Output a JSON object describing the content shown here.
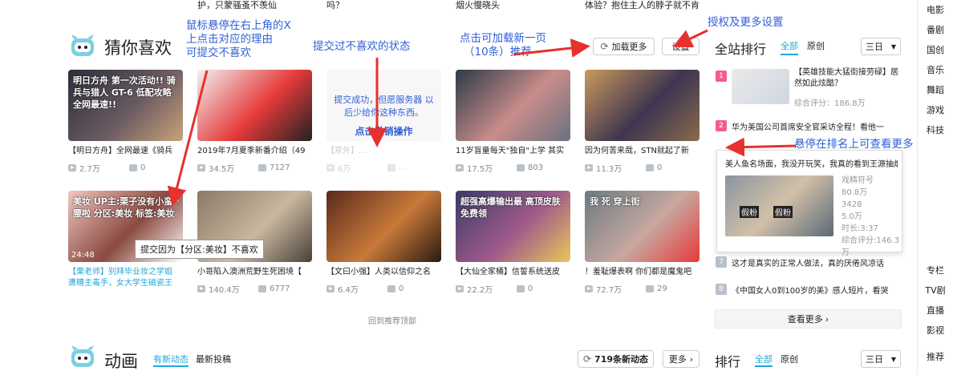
{
  "top_snippets": [
    "护，只蒙骚蚤不羡仙",
    "吗？",
    "烟火慢晓头",
    "体验？抱住主人的脖子就不肯"
  ],
  "section1": {
    "title": "猜你喜欢",
    "load_more_label": "加载更多",
    "settings_label": "设置",
    "back_to_top": "回到推荐顶部"
  },
  "cards_row1": [
    {
      "thumb_text": "明日方舟 第一次活动!! 骑兵与猎人 GT-6 低配攻略 全网最速!!",
      "title": "【明日方舟】全网最速《骑兵",
      "views": "2.7万",
      "danmaku": "0",
      "colors": [
        "#2b2f3a",
        "#6a5a62",
        "#c9a27a"
      ]
    },
    {
      "thumb_text": "",
      "title": "2019年7月夏季新番介绍（49",
      "views": "34.5万",
      "danmaku": "7127",
      "colors": [
        "#f1f1f1",
        "#e53a3a",
        "#222"
      ]
    },
    {
      "thumb_text": "提交成功，但愿服务器 以后少给你这种东西。",
      "undo_label": "点击撤销操作",
      "title": "【意外】...",
      "views": "6万",
      "danmaku": "...",
      "colors": [
        "#f7f7f7",
        "#e8d8dc",
        "#fff"
      ]
    },
    {
      "thumb_text": "",
      "title": "11岁盲童每天\"独自\"上学 其实",
      "views": "17.5万",
      "danmaku": "803",
      "colors": [
        "#2d3a48",
        "#c88d8a",
        "#6b7080"
      ]
    },
    {
      "thumb_text": "",
      "title": "因为何苦来哉，STN就起了新",
      "views": "11.3万",
      "danmaku": "0",
      "colors": [
        "#c99a5a",
        "#3d3550",
        "#8a6a4a"
      ]
    }
  ],
  "cards_row2": [
    {
      "thumb_text": "美妆 UP主:栗子没有小蛮腰啦 分区:美妆 标签:美妆",
      "duration": "24:48",
      "title": "【栗老师】别拜毕业妆之学姐 遭糟主毒手，女大学生磁瓷王",
      "views": "",
      "danmaku": "",
      "colors": [
        "#f2c6c0",
        "#8a4a40",
        "#fff"
      ]
    },
    {
      "thumb_text": "",
      "title": "小哥陷入澳洲荒野生死困境【",
      "views": "140.4万",
      "danmaku": "6777",
      "colors": [
        "#8a7a66",
        "#c8b8a0",
        "#4a4038"
      ]
    },
    {
      "thumb_text": "",
      "title": "【文曰小强】人类以信仰之名",
      "views": "6.4万",
      "danmaku": "0",
      "colors": [
        "#5a2a1a",
        "#c87a3a",
        "#2a1a10"
      ]
    },
    {
      "thumb_text": "超强高爆输出最 高顶皮肤免费领",
      "title": "【大仙全家桶】信誓系统送皮",
      "views": "22.2万",
      "danmaku": "0",
      "colors": [
        "#3a3a6a",
        "#a05a8a",
        "#e8c85a"
      ]
    },
    {
      "thumb_text": "我 死 穿上街",
      "title": "！羞耻爆表啊 你们都是魔鬼吧",
      "views": "72.7万",
      "danmaku": "29",
      "colors": [
        "#6a7a80",
        "#c8a8a0",
        "#e53a3a"
      ]
    }
  ],
  "dislike_tooltip": "提交因为【分区:美妆】不喜欢",
  "annotations": {
    "a1": [
      "鼠标悬停在右上角的X",
      "上点击对应的理由",
      "可提交不喜欢"
    ],
    "a2": "提交过不喜欢的状态",
    "a3": [
      "点击可加载新一页",
      "（10条）推荐"
    ],
    "a4": "授权及更多设置",
    "a5": "悬停在排名上可查看更多"
  },
  "ranking": {
    "title": "全站排行",
    "tab_all": "全部",
    "tab_original": "原创",
    "period": "三日",
    "items": [
      {
        "num": "1",
        "title": "【英雄技能大猛街接劳碌】居然如此炫酷？",
        "score": "综合评分：186.8万"
      },
      {
        "num": "2",
        "title": "华为美国公司首席安全官采访全程！看他一"
      },
      {
        "num": "7",
        "title": "这才是真实的正常人做法，真的厌倦风凉话"
      },
      {
        "num": "8",
        "title": "《中国女人0到100岁的美》感人短片，看哭"
      }
    ],
    "more_label": "查看更多",
    "popup": {
      "title": "美人鱼名场面，我没开玩笑，我真的看到王源抽烟。",
      "author": "戏精符号",
      "views": "80.8万",
      "danmaku": "3428",
      "favs": "5.0万",
      "duration": "时长:3:37",
      "score": "综合评分:146.3万"
    }
  },
  "section2": {
    "title": "动画",
    "tab_new": "有新动态",
    "tab_latest": "最新投稿",
    "new_count": "719条新动态",
    "more": "更多",
    "rank_title": "排行",
    "rank_all": "全部",
    "rank_orig": "原创",
    "period": "三日"
  },
  "sidebar": [
    "电影",
    "番剧",
    "国创",
    "音乐",
    "舞蹈",
    "游戏",
    "科技",
    "专栏",
    "TV剧",
    "直播",
    "影视",
    "推荐"
  ]
}
